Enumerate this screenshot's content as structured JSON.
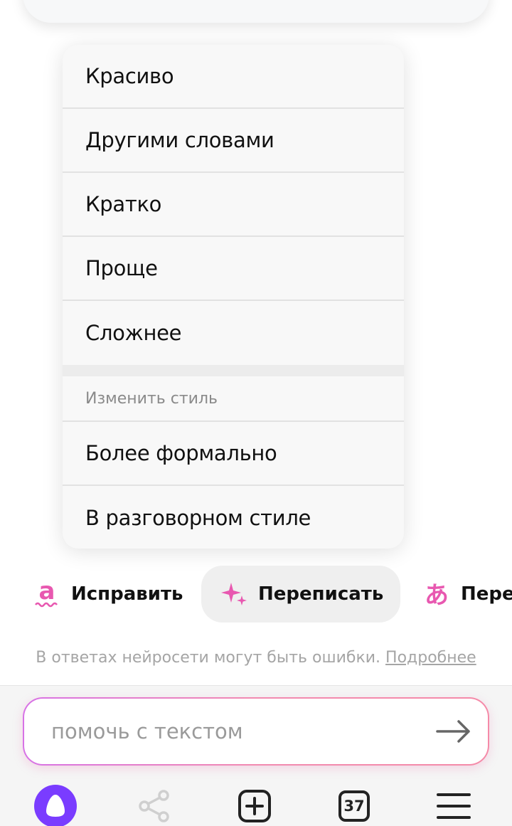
{
  "menu": {
    "items": [
      "Красиво",
      "Другими словами",
      "Кратко",
      "Проще",
      "Сложнее"
    ],
    "section_label": "Изменить стиль",
    "style_items": [
      "Более формально",
      "В разговорном стиле"
    ]
  },
  "actions": {
    "fix_label": "Исправить",
    "rewrite_label": "Переписать",
    "translate_label": "Пере"
  },
  "disclaimer": {
    "text": "В ответах нейросети могут быть ошибки.",
    "link": "Подробнее"
  },
  "input": {
    "placeholder": "помочь с текстом",
    "value": ""
  },
  "nav": {
    "tabs_count": "37"
  },
  "colors": {
    "accent_pink": "#e858b0",
    "alice_purple": "#7a3cff"
  },
  "icons": {
    "fix": "letter-a-squiggle-icon",
    "rewrite": "sparkles-icon",
    "translate": "hiragana-a-icon",
    "send": "arrow-right-icon",
    "alice": "alice-assistant-icon",
    "share": "share-icon",
    "new_tab": "plus-square-icon",
    "tabs": "tabs-count-icon",
    "menu": "hamburger-menu-icon"
  }
}
